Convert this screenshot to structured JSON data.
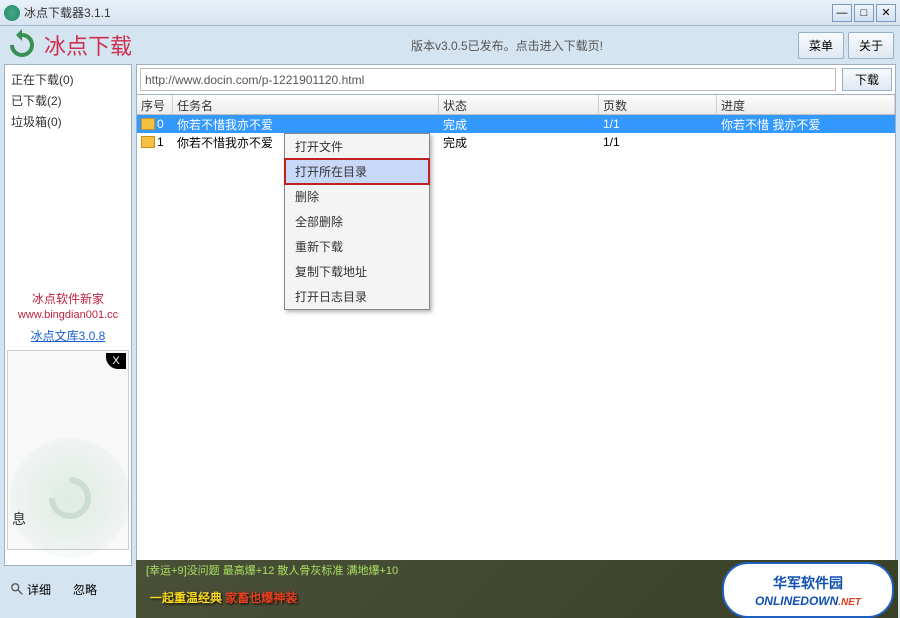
{
  "window": {
    "title": "冰点下载器3.1.1"
  },
  "header": {
    "app_name": "冰点下载",
    "version_text": "版本v3.0.5已发布。点击进入下载页!",
    "menu_btn": "菜单",
    "about_btn": "关于"
  },
  "sidebar": {
    "items": [
      {
        "label": "正在下载(0)"
      },
      {
        "label": "已下载(2)"
      },
      {
        "label": "垃圾箱(0)"
      }
    ],
    "promo_title": "冰点软件新家",
    "promo_url": "www.bingdian001.cc",
    "promo_link": "冰点文库3.0.8",
    "ad_close": "X",
    "ad_text": "息"
  },
  "url_bar": {
    "value": "http://www.docin.com/p-1221901120.html",
    "download_btn": "下载"
  },
  "table": {
    "headers": [
      "序号",
      "任务名",
      "状态",
      "页数",
      "进度"
    ],
    "rows": [
      {
        "idx": "0",
        "name": "你若不惜我亦不爱",
        "status": "完成",
        "pages": "1/1",
        "progress": "你若不惜 我亦不爱"
      },
      {
        "idx": "1",
        "name": "你若不惜我亦不爱",
        "status": "完成",
        "pages": "1/1",
        "progress": ""
      }
    ]
  },
  "context_menu": {
    "items": [
      "打开文件",
      "打开所在目录",
      "删除",
      "全部删除",
      "重新下载",
      "复制下载地址",
      "打开日志目录"
    ],
    "highlighted_index": 1
  },
  "bottom": {
    "detail_btn": "详细",
    "ignore_btn": "忽略"
  },
  "banner": {
    "stats": "[幸运+9]没问题 最高爆+12 散人骨灰标准 满地爆+10",
    "text_1": "一起重温经典 ",
    "text_2": "家畜也爆神装",
    "logo_cn": "华军软件园",
    "logo_en": "ONLINEDOWN",
    "logo_net": ".NET"
  }
}
